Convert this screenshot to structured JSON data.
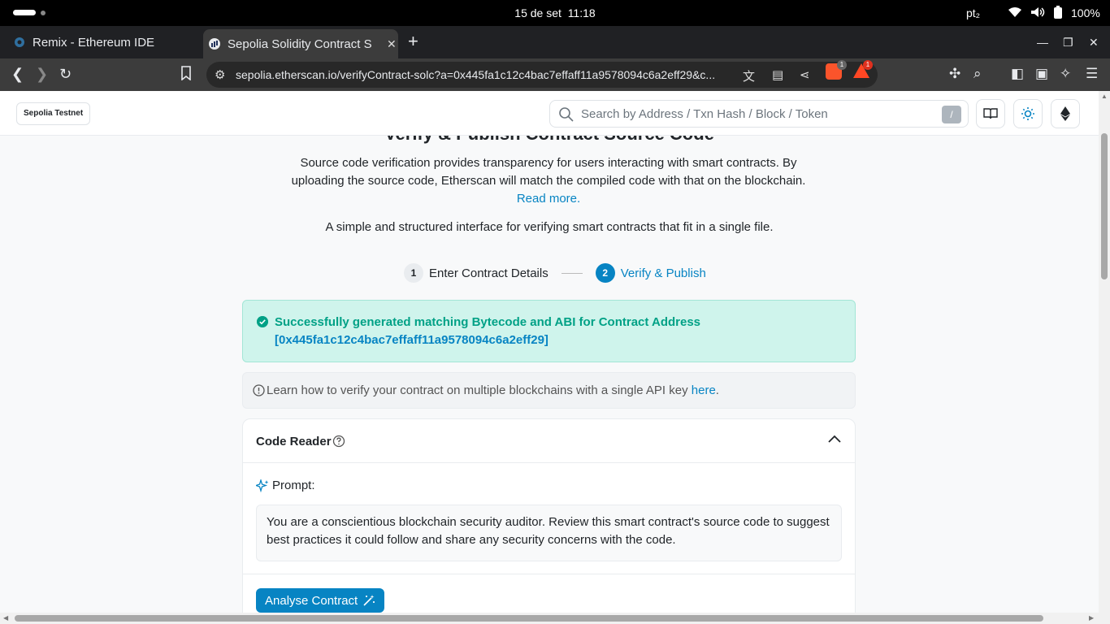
{
  "os": {
    "date": "15 de set",
    "time": "11:18",
    "keyboard": "pt₂",
    "battery": "100%"
  },
  "tabs": [
    {
      "title": "Remix - Ethereum IDE",
      "active": false
    },
    {
      "title": "Sepolia Solidity Contract S",
      "active": true
    }
  ],
  "address_bar": {
    "url": "sepolia.etherscan.io/verifyContract-solc?a=0x445fa1c12c4bac7effaff11a9578094c6a2eff29&c...",
    "brave_shield_count": "1",
    "rewards_count": "1"
  },
  "site_header": {
    "network_badge": "Sepolia Testnet",
    "search_placeholder": "Search by Address / Txn Hash / Block / Token",
    "search_shortcut": "/"
  },
  "main": {
    "heading": "Verify & Publish Contract Source Code",
    "description": "Source code verification provides transparency for users interacting with smart contracts. By uploading the source code, Etherscan will match the compiled code with that on the blockchain.",
    "read_more": "Read more.",
    "subdescription": "A simple and structured interface for verifying smart contracts that fit in a single file.",
    "steps": [
      {
        "num": "1",
        "label": "Enter Contract Details",
        "active": false
      },
      {
        "num": "2",
        "label": "Verify & Publish",
        "active": true
      }
    ],
    "success_message": "Successfully generated matching Bytecode and ABI for Contract Address",
    "contract_address": "[0x445fa1c12c4bac7effaff11a9578094c6a2eff29]",
    "info_text": "Learn how to verify your contract on multiple blockchains with a single API key",
    "info_link": "here",
    "info_period": "."
  },
  "code_reader": {
    "title": "Code Reader",
    "prompt_label": "Prompt:",
    "prompt_text": "You are a conscientious blockchain security auditor. Review this smart contract's source code to suggest best practices it could follow and share any security concerns with the code.",
    "analyse_button": "Analyse Contract"
  },
  "colors": {
    "accent": "#0784c3",
    "success": "#00a186",
    "success_bg": "#cff4ec"
  }
}
